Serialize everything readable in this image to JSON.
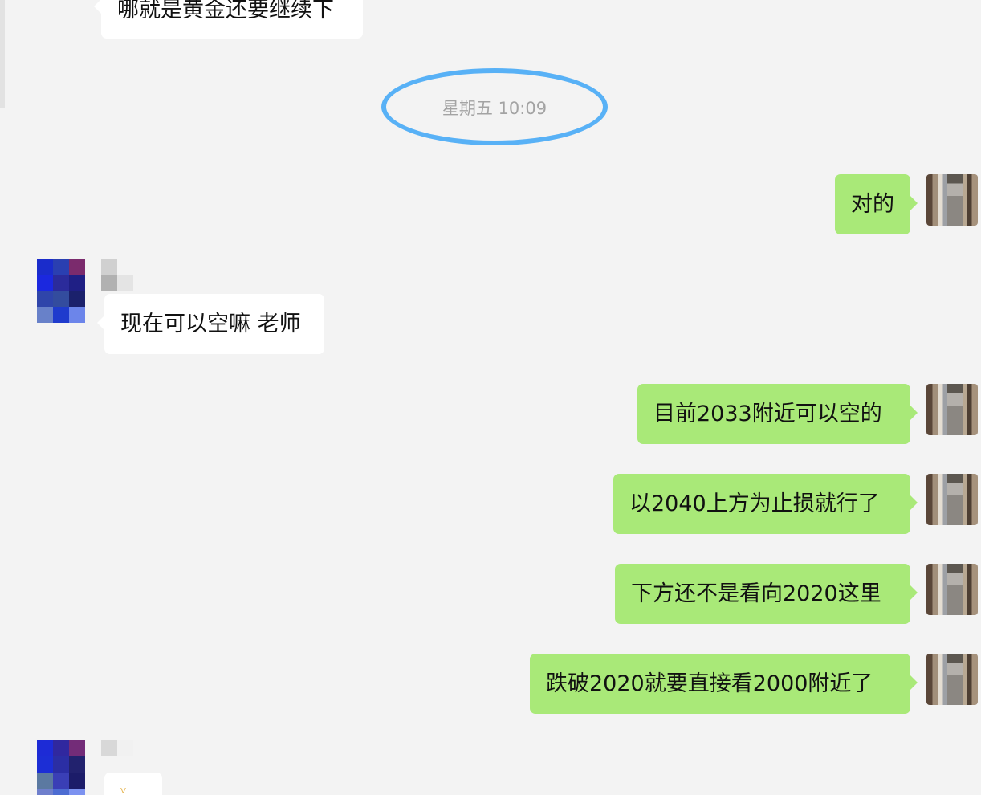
{
  "chat": {
    "timestamp": "星期五 10:09",
    "messages": [
      {
        "id": "m0",
        "side": "in",
        "text": "哪就是黄金还要继续下"
      },
      {
        "id": "m1",
        "side": "out",
        "text": "对的"
      },
      {
        "id": "m2",
        "side": "in",
        "text": "现在可以空嘛 老师"
      },
      {
        "id": "m3",
        "side": "out",
        "text": "目前2033附近可以空的"
      },
      {
        "id": "m4",
        "side": "out",
        "text": "以2040上方为止损就行了"
      },
      {
        "id": "m5",
        "side": "out",
        "text": "下方还不是看向2020这里"
      },
      {
        "id": "m6",
        "side": "out",
        "text": "跌破2020就要直接看2000附近了"
      },
      {
        "id": "m7",
        "side": "in",
        "text": ""
      }
    ],
    "partial_emoji": "ⱽ"
  },
  "colors": {
    "background": "#f3f3f3",
    "incoming_bubble": "#ffffff",
    "outgoing_bubble": "#a9e978",
    "timestamp_text": "#a3a3a3",
    "highlight_ellipse": "#58b1f6"
  },
  "avatars": {
    "other_user": "pixelated-avatar",
    "me": "photo-avatar"
  }
}
